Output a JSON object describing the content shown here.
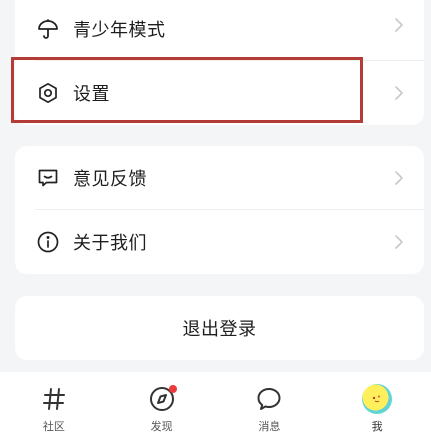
{
  "menu": {
    "youth_mode": "青少年模式",
    "settings": "设置",
    "feedback": "意见反馈",
    "about": "关于我们"
  },
  "logout_label": "退出登录",
  "tabs": [
    {
      "label": "社区",
      "icon": "hash-icon"
    },
    {
      "label": "发现",
      "icon": "compass-icon"
    },
    {
      "label": "消息",
      "icon": "chat-bubble-icon"
    },
    {
      "label": "我",
      "icon": "avatar-icon"
    }
  ],
  "colors": {
    "highlight": "#b43c36",
    "badge": "#ee3a3a",
    "background": "#f4f5f7"
  }
}
